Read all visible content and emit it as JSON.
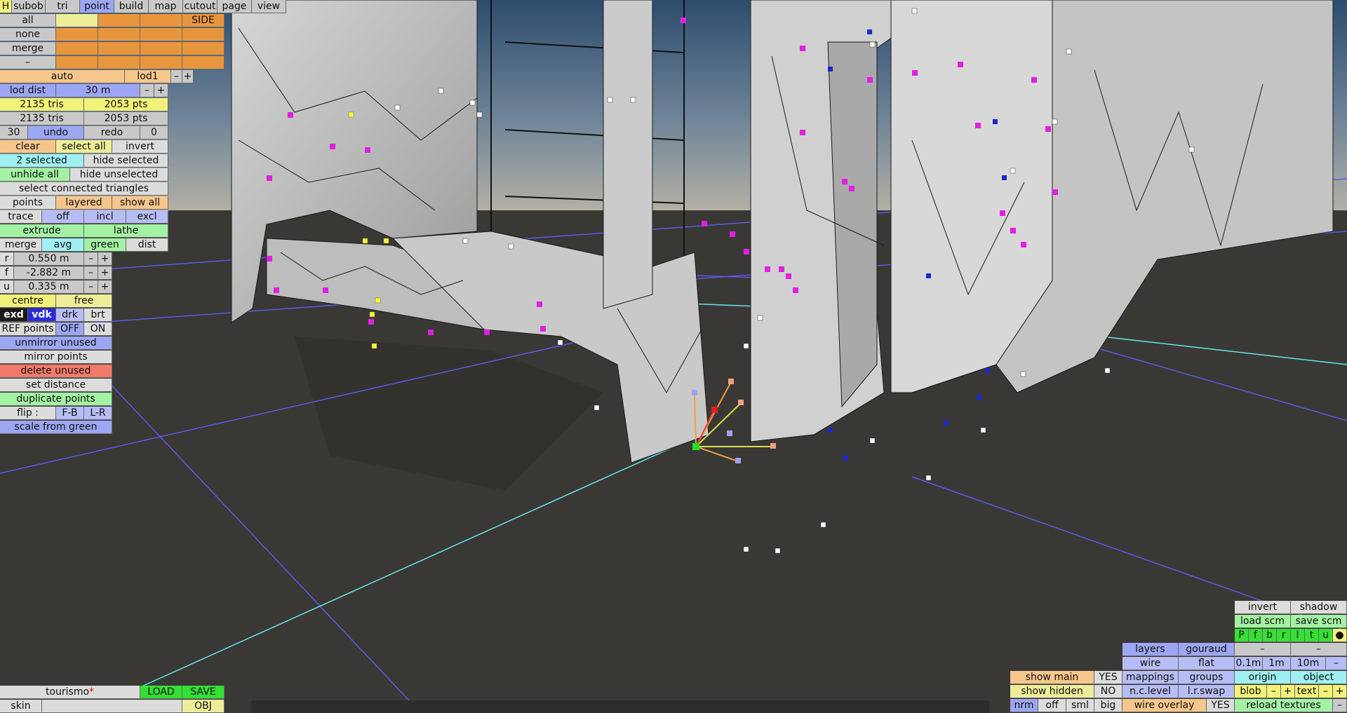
{
  "colors": {
    "sky_top": "#2e4c6e",
    "sky_bottom": "#b9b3a6",
    "ground": "#3a3835",
    "mesh": "#cfcfcf",
    "wire": "#1a1a1a",
    "grid": "#5a5ae6",
    "axis": "#63e6e6",
    "vertex": "#ffffff",
    "selected_vertex": "#ffff33",
    "magenta_vertex": "#e020e0",
    "blue_vertex": "#1a2acc"
  },
  "menu": {
    "h": "H",
    "tabs": [
      "subob",
      "tri",
      "point",
      "build",
      "map",
      "cutout",
      "page",
      "view"
    ],
    "active": "point"
  },
  "lod_panel": {
    "all": "all",
    "none": "none",
    "merge": "merge",
    "dash": "–",
    "side": "SIDE"
  },
  "panel": {
    "auto": "auto",
    "lod1": "lod1",
    "minus": "–",
    "plus": "+",
    "lod_dist_label": "lod dist",
    "lod_dist_value": "30 m",
    "tris1": "2135 tris",
    "pts1": "2053 pts",
    "tris2": "2135 tris",
    "pts2": "2053 pts",
    "undo_count": "30",
    "undo": "undo",
    "redo": "redo",
    "redo_count": "0",
    "clear": "clear",
    "select_all": "select all",
    "invert": "invert",
    "selected": "2 selected",
    "hide_selected": "hide selected",
    "unhide_all": "unhide all",
    "hide_unselected": "hide unselected",
    "select_connected": "select connected triangles",
    "points": "points",
    "layered": "layered",
    "show_all": "show all",
    "trace": "trace",
    "off": "off",
    "incl": "incl",
    "excl": "excl",
    "extrude": "extrude",
    "lathe": "lathe",
    "merge": "merge",
    "avg": "avg",
    "green": "green",
    "dist": "dist",
    "r_label": "r",
    "r_value": "0.550 m",
    "f_label": "f",
    "f_value": "-2.882 m",
    "u_label": "u",
    "u_value": "0.335 m",
    "centre": "centre",
    "free": "free",
    "exd": "exd",
    "vdk": "vdk",
    "drk": "drk",
    "brt": "brt",
    "ref_points": "REF points",
    "ref_off": "OFF",
    "ref_on": "ON",
    "unmirror_unused": "unmirror unused",
    "mirror_points": "mirror points",
    "delete_unused": "delete unused",
    "set_distance": "set distance",
    "duplicate_points": "duplicate points",
    "flip": "flip :",
    "fb": "F-B",
    "lr": "L-R",
    "scale_from_green": "scale from green"
  },
  "bottom_left": {
    "filename": "tourismo",
    "modified_mark": "*",
    "load": "LOAD",
    "save": "SAVE",
    "skin": "skin",
    "obj": "OBJ"
  },
  "bottom_right": {
    "invert": "invert",
    "shadow": "shadow",
    "load_scm": "load scm",
    "save_scm": "save scm",
    "flags": [
      "P",
      "f",
      "b",
      "r",
      "l",
      "t",
      "u",
      "●"
    ],
    "dash": "–",
    "layers": "layers",
    "gouraud": "gouraud",
    "wire": "wire",
    "flat": "flat",
    "mappings": "mappings",
    "groups": "groups",
    "nc_level": "n.c.level",
    "lr_swap": "l.r.swap",
    "grid_01": "0.1m",
    "grid_1": "1m",
    "grid_10": "10m",
    "origin": "origin",
    "object": "object",
    "blob": "blob",
    "text": "text",
    "reload_textures": "reload textures",
    "show_main": "show main",
    "show_main_val": "YES",
    "show_hidden": "show hidden",
    "show_hidden_val": "NO",
    "nrm": "nrm",
    "off": "off",
    "sml": "sml",
    "big": "big",
    "wire_overlay": "wire overlay",
    "wire_overlay_val": "YES"
  }
}
